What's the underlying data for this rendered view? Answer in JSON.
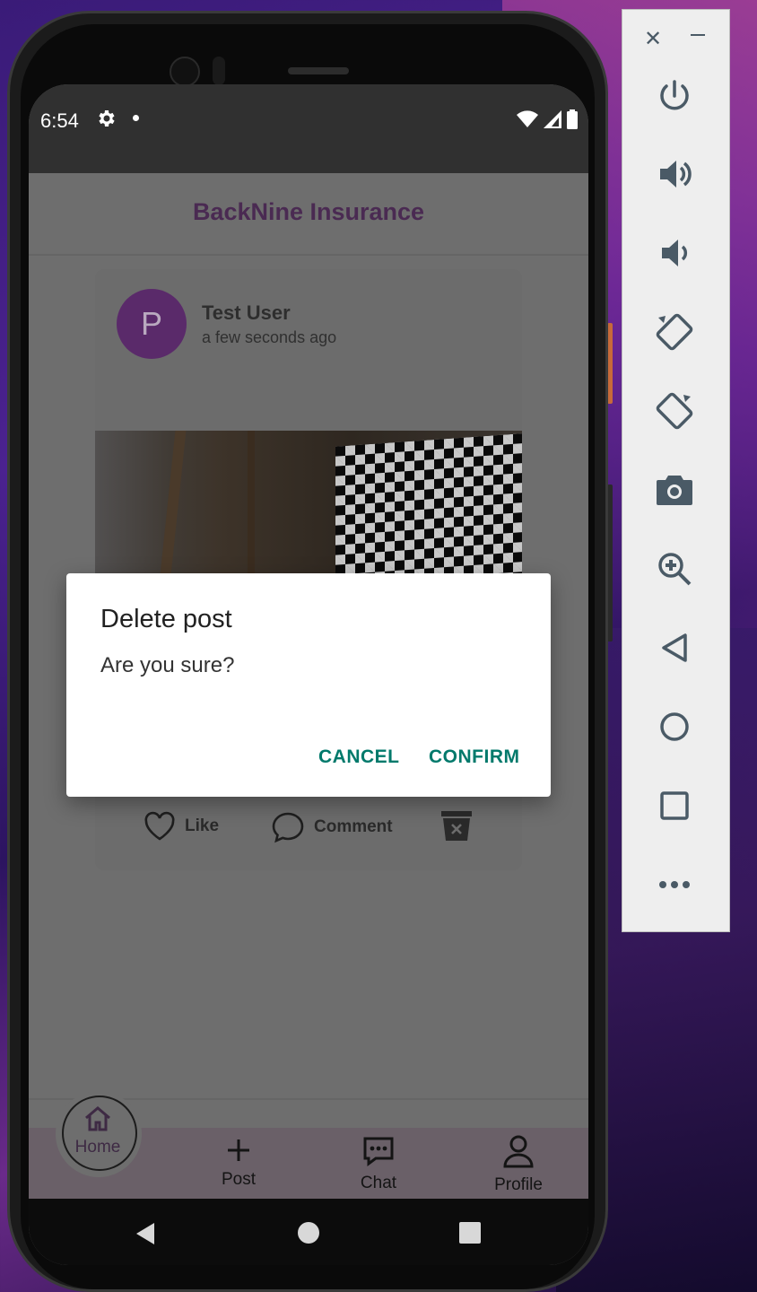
{
  "status_bar": {
    "time": "6:54"
  },
  "app": {
    "title": "BackNine Insurance"
  },
  "post": {
    "avatar_letter": "P",
    "user_name": "Test User",
    "time_ago": "a few seconds ago",
    "like_label": "Like",
    "comment_label": "Comment"
  },
  "dialog": {
    "title": "Delete post",
    "message": "Are you sure?",
    "cancel_label": "CANCEL",
    "confirm_label": "CONFIRM"
  },
  "bottom_nav": {
    "items": [
      {
        "label": "Home",
        "icon": "home-icon",
        "active": true
      },
      {
        "label": "Post",
        "icon": "plus-icon"
      },
      {
        "label": "Chat",
        "icon": "chat-icon"
      },
      {
        "label": "Profile",
        "icon": "person-icon"
      }
    ]
  },
  "emulator_panel": {
    "buttons": [
      "close-icon",
      "minimize-icon",
      "power-icon",
      "volume-up-icon",
      "volume-down-icon",
      "rotate-left-icon",
      "rotate-right-icon",
      "camera-icon",
      "zoom-icon",
      "back-icon",
      "home-icon",
      "overview-icon",
      "more-icon"
    ]
  },
  "colors": {
    "accent": "#00796b",
    "avatar": "#5a2a6a",
    "title": "#4a2a52"
  }
}
